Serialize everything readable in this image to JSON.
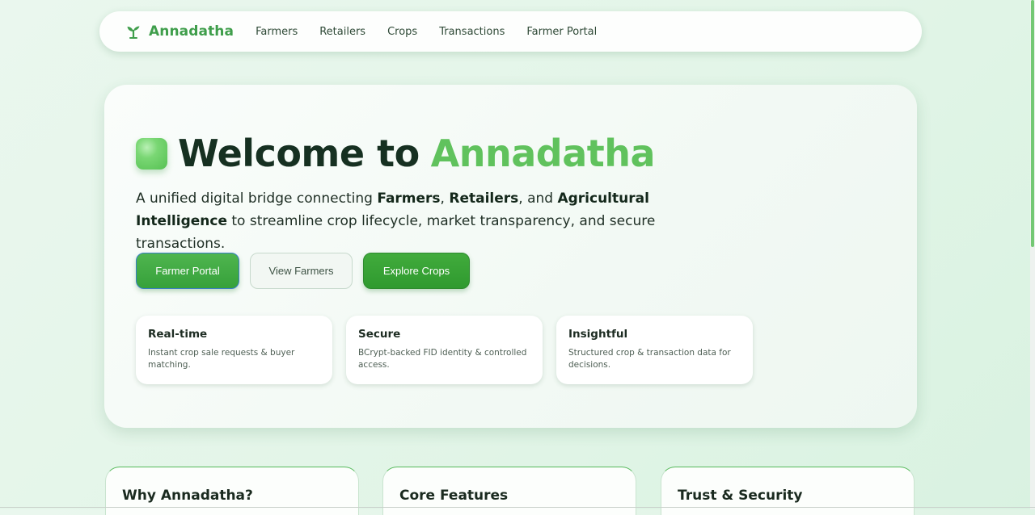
{
  "nav": {
    "brand": "Annadatha",
    "links": [
      "Farmers",
      "Retailers",
      "Crops",
      "Transactions",
      "Farmer Portal"
    ]
  },
  "hero": {
    "title_prefix": "Welcome to",
    "title_accent": "Annadatha",
    "desc_1": "A unified digital bridge connecting ",
    "desc_farmers": "Farmers",
    "desc_comma": ", ",
    "desc_retailers": "Retailers",
    "desc_and": ", and ",
    "desc_ai": "Agricultural Intelligence",
    "desc_2": " to streamline crop lifecycle, market transparency, and secure transactions.",
    "buttons": {
      "farmer_portal": "Farmer Portal",
      "view_farmers": "View Farmers",
      "explore_crops": "Explore Crops"
    },
    "features": [
      {
        "title": "Real-time",
        "desc": "Instant crop sale requests & buyer matching."
      },
      {
        "title": "Secure",
        "desc": "BCrypt-backed FID identity & controlled access."
      },
      {
        "title": "Insightful",
        "desc": "Structured crop & transaction data for decisions."
      }
    ]
  },
  "sections": [
    {
      "title": "Why Annadatha?"
    },
    {
      "title": "Core Features"
    },
    {
      "title": "Trust & Security"
    }
  ],
  "colors": {
    "brand_green": "#3f9e4b",
    "accent_green": "#60c25d",
    "button_green": "#36a13a"
  },
  "icons": {
    "brand": "sprout-icon",
    "hero_badge": "leaf-badge-icon"
  }
}
